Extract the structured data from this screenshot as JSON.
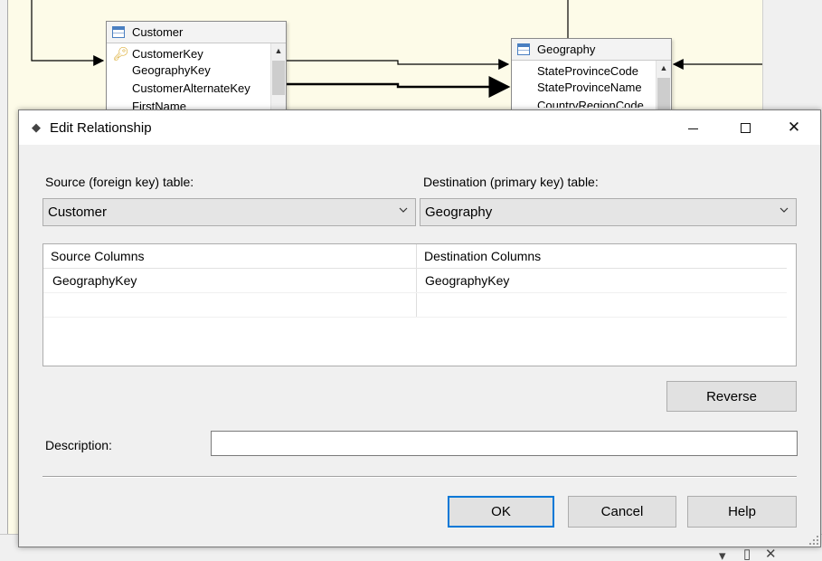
{
  "designer": {
    "customer_table": {
      "name": "Customer",
      "columns": [
        "CustomerKey",
        "GeographyKey",
        "CustomerAlternateKey",
        "FirstName"
      ]
    },
    "geography_table": {
      "name": "Geography",
      "columns": [
        "StateProvinceCode",
        "StateProvinceName",
        "CountryRegionCode"
      ]
    }
  },
  "dialog": {
    "title": "Edit Relationship",
    "source_label": "Source (foreign key) table:",
    "source_value": "Customer",
    "destination_label": "Destination (primary key) table:",
    "destination_value": "Geography",
    "grid": {
      "headers": [
        "Source Columns",
        "Destination Columns"
      ],
      "rows": [
        [
          "GeographyKey",
          "GeographyKey"
        ],
        [
          "",
          ""
        ]
      ]
    },
    "reverse_label": "Reverse",
    "description_label": "Description:",
    "description_value": "",
    "ok_label": "OK",
    "cancel_label": "Cancel",
    "help_label": "Help"
  }
}
